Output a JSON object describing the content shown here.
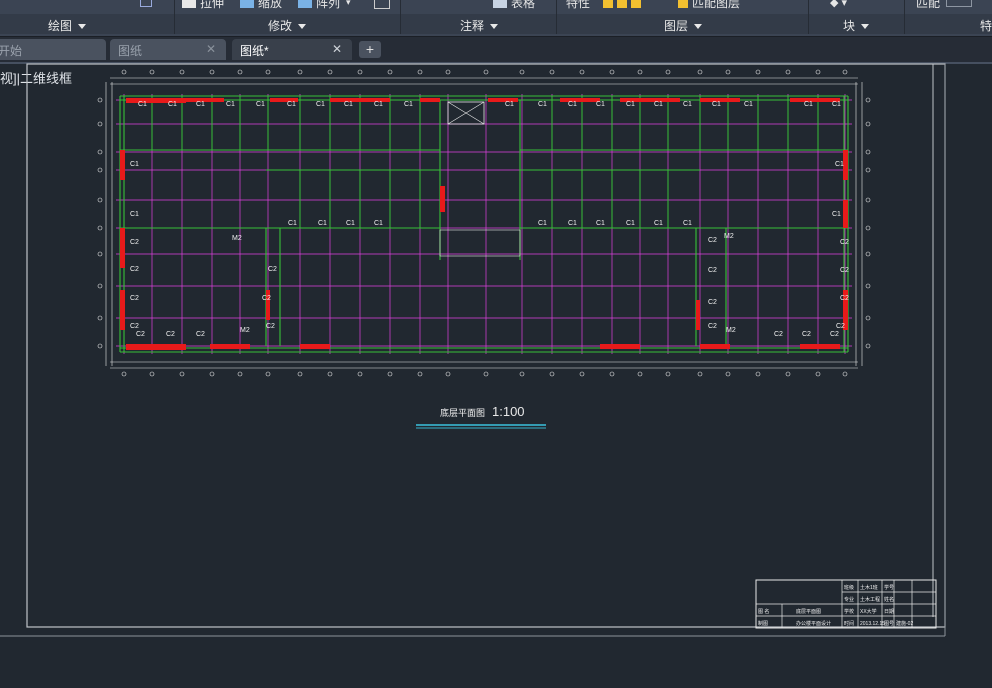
{
  "ribbon": {
    "tools": [
      {
        "label": "拉伸",
        "icon": "stretch-icon"
      },
      {
        "label": "缩放",
        "icon": "scale-icon"
      },
      {
        "label": "阵列",
        "icon": "array-icon"
      },
      {
        "label": "表格",
        "icon": "table-icon"
      },
      {
        "label": "特性",
        "icon": ""
      },
      {
        "label": "匹配图层",
        "icon": "match-layer-icon"
      },
      {
        "label": "匹配",
        "icon": ""
      }
    ],
    "panels": [
      {
        "label": "绘图"
      },
      {
        "label": "修改"
      },
      {
        "label": "注释"
      },
      {
        "label": "图层"
      },
      {
        "label": "块"
      },
      {
        "label": "特"
      }
    ]
  },
  "tabs": [
    {
      "label": "开始",
      "closable": false,
      "active": false
    },
    {
      "label": "图纸",
      "closable": true,
      "active": false
    },
    {
      "label": "图纸*",
      "closable": true,
      "active": true
    }
  ],
  "viewport": {
    "label": "视]|二维线框"
  },
  "drawing": {
    "title": "底层平面图",
    "scale": "1:100",
    "room_labels": [
      "C1",
      "C2",
      "M2"
    ],
    "title_block": [
      [
        "",
        "",
        "",
        "",
        "班级",
        "土木1班",
        "学号",
        ""
      ],
      [
        "",
        "",
        "",
        "",
        "专业",
        "土木工程",
        "姓名",
        ""
      ],
      [
        "图 名",
        "",
        "底层平面图",
        "",
        "学校",
        "XX大学",
        "日期",
        ""
      ],
      [
        "制图",
        "",
        "办公楼平面设计",
        "",
        "时间",
        "2013.12.15",
        "图号",
        "建施-02"
      ]
    ]
  },
  "colors": {
    "background": "#212830",
    "ribbon": "#3b4453",
    "axis": "#e040e0",
    "wall": "#38c038",
    "column": "#e81a1a",
    "dimension": "#40e0ff",
    "frame": "#c8c8c8"
  }
}
